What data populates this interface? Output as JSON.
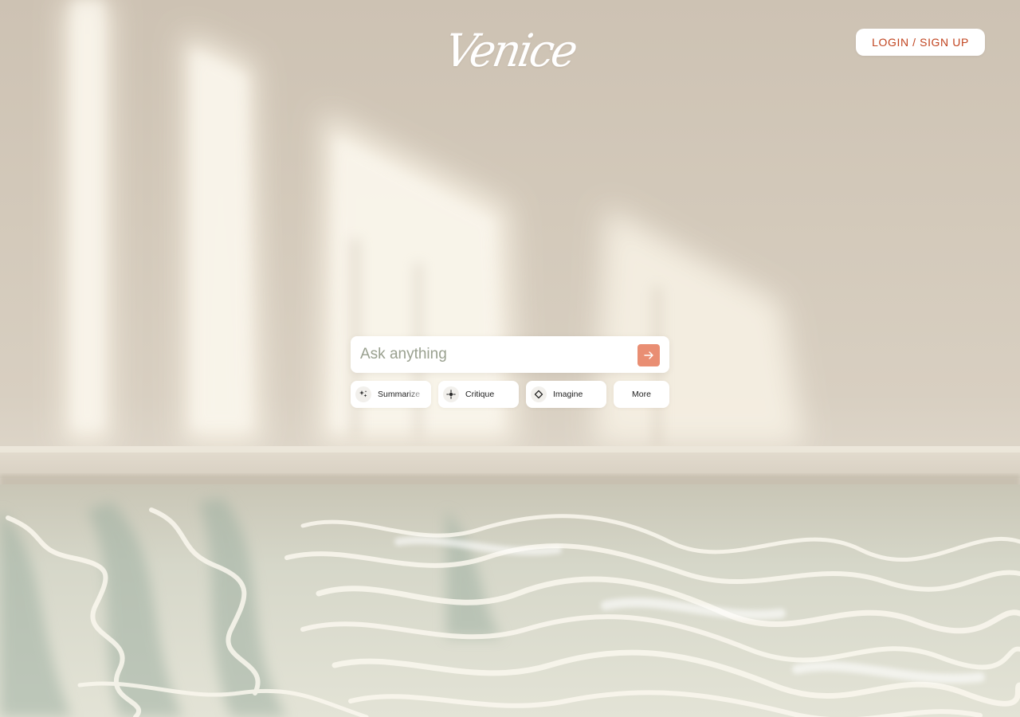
{
  "brand": {
    "logo_text": "Venice"
  },
  "header": {
    "login_label": "LOGIN / SIGN UP"
  },
  "search": {
    "placeholder": "Ask anything",
    "value": ""
  },
  "chips": [
    {
      "label": "Summarize",
      "icon": "sparkle-icon"
    },
    {
      "label": "Critique",
      "icon": "crosshair-icon"
    },
    {
      "label": "Imagine",
      "icon": "diamond-icon"
    },
    {
      "label": "More"
    }
  ],
  "colors": {
    "accent": "#c1441f",
    "send_button": "#e98e73",
    "placeholder": "#9aa190"
  }
}
